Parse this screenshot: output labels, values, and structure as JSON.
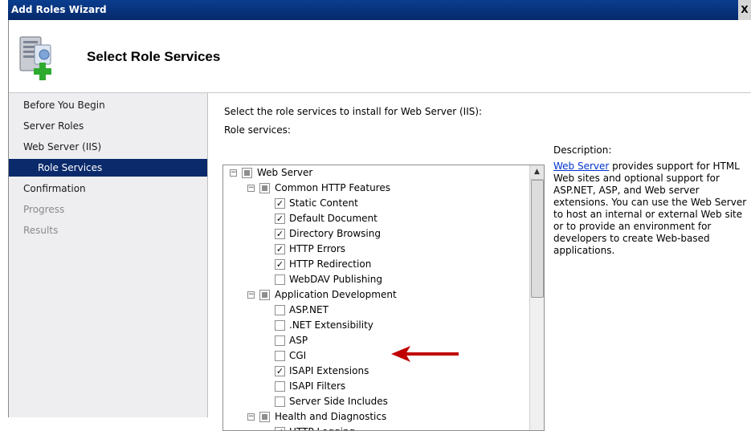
{
  "window": {
    "title": "Add Roles Wizard",
    "close_label": "X"
  },
  "header": {
    "title": "Select Role Services",
    "icon": "server-add-icon"
  },
  "nav": {
    "items": [
      {
        "label": "Before You Begin",
        "state": "normal"
      },
      {
        "label": "Server Roles",
        "state": "normal"
      },
      {
        "label": "Web Server (IIS)",
        "state": "normal"
      },
      {
        "label": "Role Services",
        "state": "selected"
      },
      {
        "label": "Confirmation",
        "state": "normal"
      },
      {
        "label": "Progress",
        "state": "disabled"
      },
      {
        "label": "Results",
        "state": "disabled"
      }
    ]
  },
  "content": {
    "instruction": "Select the role services to install for Web Server (IIS):",
    "role_services_label": "Role services:",
    "description_label": "Description:",
    "description_link": "Web Server",
    "description_text": " provides support for HTML Web sites and optional support for ASP.NET, ASP, and Web server extensions. You can use the Web Server to host an internal or external Web site or to provide an environment for developers to create Web-based applications."
  },
  "tree": [
    {
      "label": "Web Server",
      "level": 0,
      "state": "partial",
      "expander": "minus"
    },
    {
      "label": "Common HTTP Features",
      "level": 1,
      "state": "partial",
      "expander": "minus"
    },
    {
      "label": "Static Content",
      "level": 2,
      "state": "checked"
    },
    {
      "label": "Default Document",
      "level": 2,
      "state": "checked"
    },
    {
      "label": "Directory Browsing",
      "level": 2,
      "state": "checked"
    },
    {
      "label": "HTTP Errors",
      "level": 2,
      "state": "checked"
    },
    {
      "label": "HTTP Redirection",
      "level": 2,
      "state": "checked"
    },
    {
      "label": "WebDAV Publishing",
      "level": 2,
      "state": "unchecked"
    },
    {
      "label": "Application Development",
      "level": 1,
      "state": "partial",
      "expander": "minus"
    },
    {
      "label": "ASP.NET",
      "level": 2,
      "state": "unchecked"
    },
    {
      "label": ".NET Extensibility",
      "level": 2,
      "state": "unchecked"
    },
    {
      "label": "ASP",
      "level": 2,
      "state": "unchecked"
    },
    {
      "label": "CGI",
      "level": 2,
      "state": "unchecked"
    },
    {
      "label": "ISAPI Extensions",
      "level": 2,
      "state": "checked"
    },
    {
      "label": "ISAPI Filters",
      "level": 2,
      "state": "unchecked"
    },
    {
      "label": "Server Side Includes",
      "level": 2,
      "state": "unchecked"
    },
    {
      "label": "Health and Diagnostics",
      "level": 1,
      "state": "partial",
      "expander": "minus"
    },
    {
      "label": "HTTP Logging",
      "level": 2,
      "state": "checked"
    }
  ],
  "colors": {
    "titlebar": "#0a3d8f",
    "nav_selected": "#0a2a6b",
    "link": "#0033cc",
    "annotation_arrow": "#c00000"
  }
}
